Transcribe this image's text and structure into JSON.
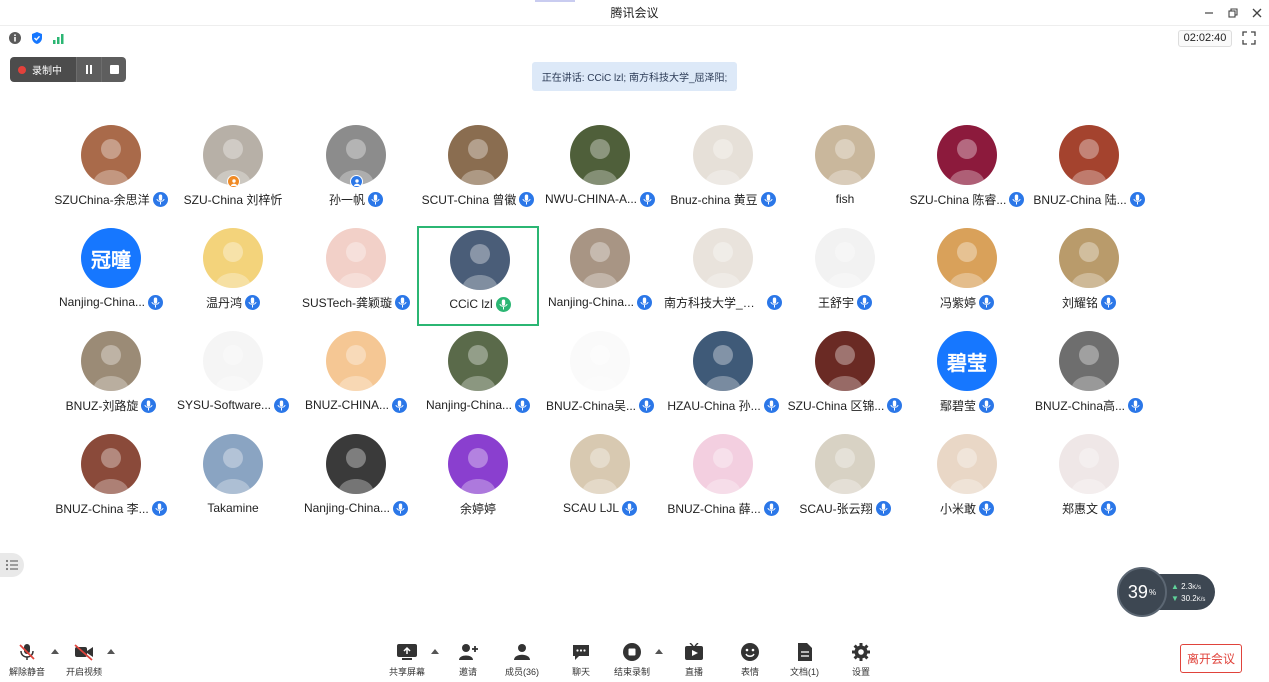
{
  "window": {
    "title": "腾讯会议",
    "timer": "02:02:40"
  },
  "recording": {
    "label": "录制中"
  },
  "speaking_banner": "正在讲话: CCiC lzl; 南方科技大学_屈泽阳;",
  "participants": [
    {
      "name": "SZUChina-余思洋",
      "avatar_icon": "cartoon-girl-avatar",
      "avatar_color": "#a96a4a",
      "mic": "on"
    },
    {
      "name": "SZU-China 刘梓忻",
      "avatar_icon": "window-photo-avatar",
      "avatar_color": "#b7b0a7",
      "mic": "none",
      "badge": "host"
    },
    {
      "name": "孙一帆",
      "avatar_icon": "cat-photo-avatar",
      "avatar_color": "#8c8c8c",
      "mic": "on",
      "badge": "cohost"
    },
    {
      "name": "SCUT-China 曾徽",
      "avatar_icon": "dog-photo-avatar",
      "avatar_color": "#8a6d50",
      "mic": "on"
    },
    {
      "name": "NWU-CHINA-A...",
      "avatar_icon": "beetle-avatar",
      "avatar_color": "#4f5f3a",
      "mic": "on"
    },
    {
      "name": "Bnuz-china 黄豆",
      "avatar_icon": "cat-figure-avatar",
      "avatar_color": "#e6e0d8",
      "mic": "on"
    },
    {
      "name": "fish",
      "avatar_icon": "puppy-photo-avatar",
      "avatar_color": "#c9b79c",
      "mic": "none"
    },
    {
      "name": "SZU-China 陈睿...",
      "avatar_icon": "tom-cat-avatar",
      "avatar_color": "#8c1a3c",
      "mic": "on"
    },
    {
      "name": "BNUZ-China 陆...",
      "avatar_icon": "food-photo-avatar",
      "avatar_color": "#a4432e",
      "mic": "on"
    },
    {
      "name": "Nanjing-China...",
      "avatar_icon": "text-avatar",
      "avatar_text": "冠曈",
      "avatar_color": "#1677ff",
      "mic": "on"
    },
    {
      "name": "温丹鸿",
      "avatar_icon": "cartoon-boy-avatar",
      "avatar_color": "#f3d37b",
      "mic": "on"
    },
    {
      "name": "SUSTech-龚颖璇",
      "avatar_icon": "cartoon-kid-avatar",
      "avatar_color": "#f2d0c8",
      "mic": "on"
    },
    {
      "name": "CCiC lzl",
      "avatar_icon": "silhouette-avatar",
      "avatar_color": "#4a5d78",
      "mic": "speaking",
      "active": true
    },
    {
      "name": "Nanjing-China...",
      "avatar_icon": "person-lying-avatar",
      "avatar_color": "#a89584",
      "mic": "on"
    },
    {
      "name": "南方科技大学_屈...",
      "avatar_icon": "sketch-face-avatar",
      "avatar_color": "#e9e3dc",
      "mic": "on-filled"
    },
    {
      "name": "王舒宇",
      "avatar_icon": "anime-sketch-avatar",
      "avatar_color": "#f2f2f2",
      "mic": "on"
    },
    {
      "name": "冯紫婷",
      "avatar_icon": "bear-avatar",
      "avatar_color": "#d9a15a",
      "mic": "on"
    },
    {
      "name": "刘耀铭",
      "avatar_icon": "kitten-avatar",
      "avatar_color": "#b99b6b",
      "mic": "on"
    },
    {
      "name": "BNUZ-刘路旋",
      "avatar_icon": "wildcat-avatar",
      "avatar_color": "#9b8b76",
      "mic": "on"
    },
    {
      "name": "SYSU-Software...",
      "avatar_icon": "white-creature-avatar",
      "avatar_color": "#f5f5f5",
      "mic": "on"
    },
    {
      "name": "BNUZ-CHINA...",
      "avatar_icon": "cats-illustration-avatar",
      "avatar_color": "#f5c794",
      "mic": "on"
    },
    {
      "name": "Nanjing-China...",
      "avatar_icon": "outdoor-photo-avatar",
      "avatar_color": "#5a6a4a",
      "mic": "on"
    },
    {
      "name": "BNUZ-China吴...",
      "avatar_icon": "line-girl-avatar",
      "avatar_color": "#fafafa",
      "mic": "on"
    },
    {
      "name": "HZAU-China 孙...",
      "avatar_icon": "anime-boy-avatar",
      "avatar_color": "#3f5a78",
      "mic": "on"
    },
    {
      "name": "SZU-China 区锦...",
      "avatar_icon": "anime-girl-avatar",
      "avatar_color": "#6a2a24",
      "mic": "on"
    },
    {
      "name": "鄢碧莹",
      "avatar_icon": "text-avatar",
      "avatar_text": "碧莹",
      "avatar_color": "#1677ff",
      "mic": "on"
    },
    {
      "name": "BNUZ-China高...",
      "avatar_icon": "bw-photo-avatar",
      "avatar_color": "#6e6e6e",
      "mic": "on"
    },
    {
      "name": "BNUZ-China 李...",
      "avatar_icon": "flower-avatar",
      "avatar_color": "#8a4a3a",
      "mic": "on"
    },
    {
      "name": "Takamine",
      "avatar_icon": "shiba-avatar",
      "avatar_color": "#8aa4c2",
      "mic": "none"
    },
    {
      "name": "Nanjing-China...",
      "avatar_icon": "piano-bw-avatar",
      "avatar_color": "#3a3a3a",
      "mic": "on"
    },
    {
      "name": "余婷婷",
      "avatar_icon": "purple-girl-avatar",
      "avatar_color": "#8a3fcf",
      "mic": "none"
    },
    {
      "name": "SCAU LJL",
      "avatar_icon": "cat-toy-avatar",
      "avatar_color": "#d8c9b1",
      "mic": "on"
    },
    {
      "name": "BNUZ-China 薛...",
      "avatar_icon": "pink-elephant-avatar",
      "avatar_color": "#f3cfe0",
      "mic": "on"
    },
    {
      "name": "SCAU-张云翔",
      "avatar_icon": "anime-guy-avatar",
      "avatar_color": "#d8d2c4",
      "mic": "on"
    },
    {
      "name": "小米敢",
      "avatar_icon": "baby-avatar",
      "avatar_color": "#e9d7c6",
      "mic": "on"
    },
    {
      "name": "郑惠文",
      "avatar_icon": "anime-school-avatar",
      "avatar_color": "#efe7e7",
      "mic": "on"
    }
  ],
  "network": {
    "percent": "39",
    "percent_unit": "%",
    "upload": "2.3",
    "download": "30.2",
    "rate_unit": "K/s"
  },
  "toolbar": {
    "unmute": "解除静音",
    "start_video": "开启视频",
    "share_screen": "共享屏幕",
    "invite": "邀请",
    "members": "成员(36)",
    "chat": "聊天",
    "stop_recording": "结束录制",
    "live": "直播",
    "reactions": "表情",
    "docs": "文档(1)",
    "settings": "设置",
    "leave": "离开会议"
  },
  "colors": {
    "mic_blue": "#2b77e8",
    "speaking_green": "#2bb673",
    "leave_red": "#e0433b"
  }
}
